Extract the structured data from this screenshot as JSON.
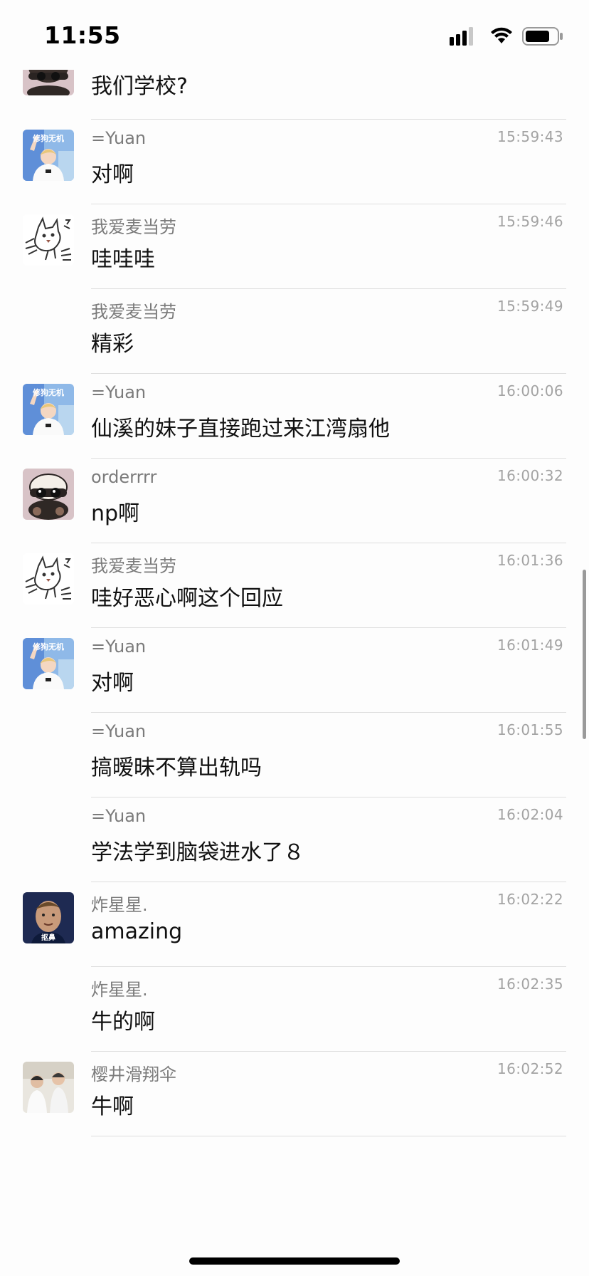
{
  "status_bar": {
    "time": "11:55"
  },
  "first_message": {
    "text": "我们学校?"
  },
  "messages": [
    {
      "sender": "=Yuan",
      "time": "15:59:43",
      "text": "对啊",
      "avatar": "yuan"
    },
    {
      "sender": "我爱麦当劳",
      "time": "15:59:46",
      "text": "哇哇哇",
      "avatar": "cat"
    },
    {
      "sender": "我爱麦当劳",
      "time": "15:59:49",
      "text": "精彩",
      "avatar": ""
    },
    {
      "sender": "=Yuan",
      "time": "16:00:06",
      "text": "仙溪的妹子直接跑过来江湾扇他",
      "avatar": "yuan"
    },
    {
      "sender": "orderrrr",
      "time": "16:00:32",
      "text": "np啊",
      "avatar": "order"
    },
    {
      "sender": "我爱麦当劳",
      "time": "16:01:36",
      "text": "哇好恶心啊这个回应",
      "avatar": "cat"
    },
    {
      "sender": "=Yuan",
      "time": "16:01:49",
      "text": "对啊",
      "avatar": "yuan"
    },
    {
      "sender": "=Yuan",
      "time": "16:01:55",
      "text": "搞暧昧不算出轨吗",
      "avatar": ""
    },
    {
      "sender": "=Yuan",
      "time": "16:02:04",
      "text": "学法学到脑袋进水了８",
      "avatar": ""
    },
    {
      "sender": "炸星星.",
      "time": "16:02:22",
      "text": "amazing",
      "avatar": "star"
    },
    {
      "sender": "炸星星.",
      "time": "16:02:35",
      "text": "牛的啊",
      "avatar": ""
    },
    {
      "sender": "樱井滑翔伞",
      "time": "16:02:52",
      "text": "牛啊",
      "avatar": "sakurai"
    }
  ],
  "avatars": {
    "yuan": {
      "name": "yuan-avatar",
      "caption": "修狗无机"
    },
    "star": {
      "name": "star-avatar",
      "caption": "抠鼻"
    }
  },
  "colors": {
    "background": "#fdfdfd",
    "sender": "#7b7b7b",
    "time": "#a3a3a3",
    "divider": "#dedede"
  }
}
